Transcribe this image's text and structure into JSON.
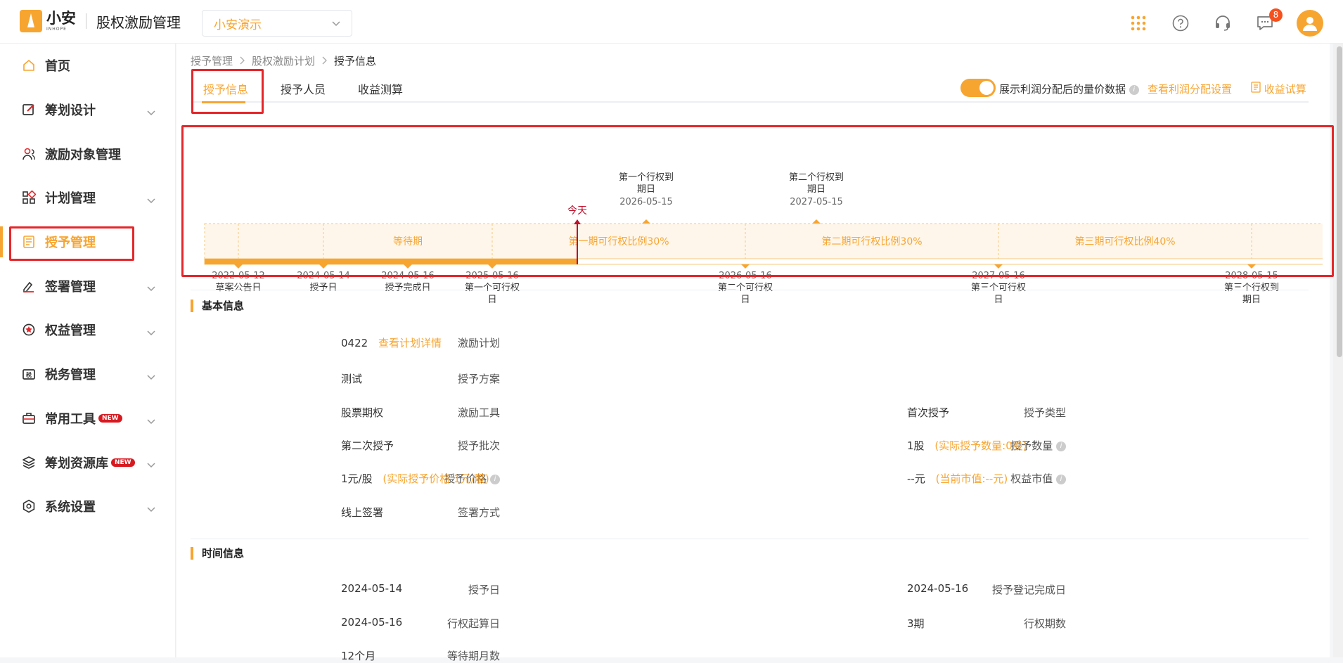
{
  "header": {
    "logo_cn": "小安",
    "logo_en": "INHOPE",
    "app_title": "股权激励管理",
    "company": "小安演示",
    "message_count": "8"
  },
  "sidebar": {
    "items": [
      {
        "label": "首页",
        "icon": "home-icon"
      },
      {
        "label": "筹划设计",
        "icon": "edit-icon"
      },
      {
        "label": "激励对象管理",
        "icon": "users-icon"
      },
      {
        "label": "计划管理",
        "icon": "grid-icon"
      },
      {
        "label": "授予管理",
        "icon": "document-icon"
      },
      {
        "label": "签署管理",
        "icon": "sign-icon"
      },
      {
        "label": "权益管理",
        "icon": "rights-icon"
      },
      {
        "label": "税务管理",
        "icon": "tax-icon"
      },
      {
        "label": "常用工具",
        "icon": "toolbox-icon",
        "tag": "NEW"
      },
      {
        "label": "筹划资源库",
        "icon": "layers-icon",
        "tag": "NEW"
      },
      {
        "label": "系统设置",
        "icon": "settings-icon"
      }
    ]
  },
  "breadcrumb": [
    "授予管理",
    "股权激励计划",
    "授予信息"
  ],
  "tabs": [
    "授予信息",
    "授予人员",
    "收益测算"
  ],
  "toolbar": {
    "toggle_label": "展示利润分配后的量价数据",
    "profit_link": "查看利润分配设置",
    "calc_link": "收益试算"
  },
  "timeline": {
    "today_label": "今天",
    "top_events": [
      {
        "line1": "第一个行权到",
        "line2": "期日",
        "date": "2026-05-15"
      },
      {
        "line1": "第二个行权到",
        "line2": "期日",
        "date": "2027-05-15"
      }
    ],
    "periods": [
      "等待期",
      "第一期可行权比例30%",
      "第二期可行权比例30%",
      "第三期可行权比例40%"
    ],
    "bottom_events": [
      {
        "date": "2022-05-12",
        "l1": "草案公告日",
        "l2": ""
      },
      {
        "date": "2024-05-14",
        "l1": "授予日",
        "l2": ""
      },
      {
        "date": "2024-05-16",
        "l1": "授予完成日",
        "l2": ""
      },
      {
        "date": "2025-05-16",
        "l1": "第一个可行权",
        "l2": "日"
      },
      {
        "date": "2026-05-16",
        "l1": "第二个可行权",
        "l2": "日"
      },
      {
        "date": "2027-05-16",
        "l1": "第三个可行权",
        "l2": "日"
      },
      {
        "date": "2028-05-15",
        "l1": "第三个行权到",
        "l2": "期日"
      }
    ]
  },
  "basic_info": {
    "title": "基本信息",
    "plan_label": "激励计划",
    "plan_value": "0422",
    "plan_link": "查看计划详情",
    "scheme_label": "授予方案",
    "scheme_value": "测试",
    "tool_label": "激励工具",
    "tool_value": "股票期权",
    "type_label": "授予类型",
    "type_value": "首次授予",
    "batch_label": "授予批次",
    "batch_value": "第二次授予",
    "qty_label": "授予数量",
    "qty_value": "1股",
    "qty_sub": "(实际授予数量:0股)",
    "price_label": "授予价格",
    "price_value": "1元/股",
    "price_sub": "(实际授予价格:1元/股)",
    "market_label": "权益市值",
    "market_value": "--元",
    "market_sub": "(当前市值:--元)",
    "sign_label": "签署方式",
    "sign_value": "线上签署"
  },
  "time_info": {
    "title": "时间信息",
    "grant_label": "授予日",
    "grant_value": "2024-05-14",
    "reg_label": "授予登记完成日",
    "reg_value": "2024-05-16",
    "start_label": "行权起算日",
    "start_value": "2024-05-16",
    "periods_label": "行权期数",
    "periods_value": "3期",
    "wait_label": "等待期月数",
    "wait_value": "12个月"
  },
  "colors": {
    "accent": "#f7a531",
    "highlight_box": "#e5262a",
    "today": "#c0102b"
  }
}
